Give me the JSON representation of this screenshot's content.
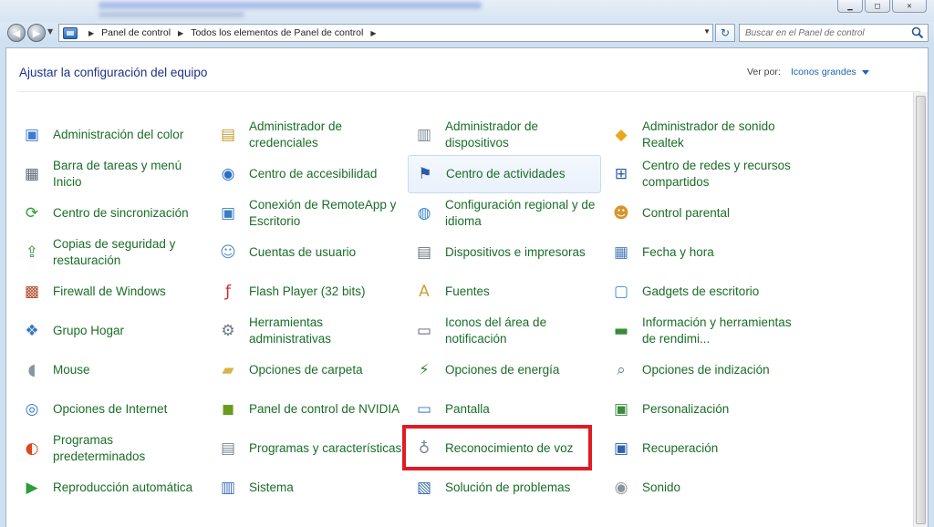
{
  "window": {
    "minimize": "▁",
    "maximize": "□",
    "close": "✕"
  },
  "nav": {
    "back": "◀",
    "forward": "▶",
    "breadcrumbs": [
      "Panel de control",
      "Todos los elementos de Panel de control"
    ],
    "search_placeholder": "Buscar en el Panel de control"
  },
  "header": {
    "title": "Ajustar la configuración del equipo",
    "view_by_label": "Ver por:",
    "view_by_value": "Iconos grandes"
  },
  "colors": {
    "item_text": "#1a6d28",
    "heading": "#1e3287",
    "link": "#1e62b5",
    "highlight_box": "#e01b24"
  },
  "items": [
    {
      "label": "Administración del color",
      "icon": "color-management-icon"
    },
    {
      "label": "Administrador de credenciales",
      "icon": "credentials-icon"
    },
    {
      "label": "Administrador de dispositivos",
      "icon": "device-manager-icon"
    },
    {
      "label": "Administrador de sonido Realtek",
      "icon": "realtek-icon"
    },
    {
      "label": "Barra de tareas y menú Inicio",
      "icon": "taskbar-icon"
    },
    {
      "label": "Centro de accesibilidad",
      "icon": "accessibility-icon"
    },
    {
      "label": "Centro de actividades",
      "icon": "action-center-flag-icon"
    },
    {
      "label": "Centro de redes y recursos compartidos",
      "icon": "network-icon"
    },
    {
      "label": "Centro de sincronización",
      "icon": "sync-icon"
    },
    {
      "label": "Conexión de RemoteApp y Escritorio",
      "icon": "remoteapp-icon"
    },
    {
      "label": "Configuración regional y de idioma",
      "icon": "globe-clock-icon"
    },
    {
      "label": "Control parental",
      "icon": "parental-control-icon"
    },
    {
      "label": "Copias de seguridad y restauración",
      "icon": "backup-icon"
    },
    {
      "label": "Cuentas de usuario",
      "icon": "users-icon"
    },
    {
      "label": "Dispositivos e impresoras",
      "icon": "printer-icon"
    },
    {
      "label": "Fecha y hora",
      "icon": "calendar-clock-icon"
    },
    {
      "label": "Firewall de Windows",
      "icon": "firewall-icon"
    },
    {
      "label": "Flash Player (32 bits)",
      "icon": "flash-icon"
    },
    {
      "label": "Fuentes",
      "icon": "fonts-icon"
    },
    {
      "label": "Gadgets de escritorio",
      "icon": "gadgets-icon"
    },
    {
      "label": "Grupo Hogar",
      "icon": "homegroup-icon"
    },
    {
      "label": "Herramientas administrativas",
      "icon": "admin-tools-icon"
    },
    {
      "label": "Iconos del área de notificación",
      "icon": "notification-area-icon"
    },
    {
      "label": "Información y herramientas de rendimi...",
      "icon": "performance-icon"
    },
    {
      "label": "Mouse",
      "icon": "mouse-icon"
    },
    {
      "label": "Opciones de carpeta",
      "icon": "folder-options-icon"
    },
    {
      "label": "Opciones de energía",
      "icon": "power-icon"
    },
    {
      "label": "Opciones de indización",
      "icon": "indexing-icon"
    },
    {
      "label": "Opciones de Internet",
      "icon": "internet-options-icon"
    },
    {
      "label": "Panel de control de NVIDIA",
      "icon": "nvidia-icon"
    },
    {
      "label": "Pantalla",
      "icon": "display-icon"
    },
    {
      "label": "Personalización",
      "icon": "personalization-icon"
    },
    {
      "label": "Programas predeterminados",
      "icon": "default-programs-icon"
    },
    {
      "label": "Programas y características",
      "icon": "programs-features-icon"
    },
    {
      "label": "Reconocimiento de voz",
      "icon": "microphone-icon"
    },
    {
      "label": "Recuperación",
      "icon": "recovery-icon"
    },
    {
      "label": "Reproducción automática",
      "icon": "autoplay-icon"
    },
    {
      "label": "Sistema",
      "icon": "system-icon"
    },
    {
      "label": "Solución de problemas",
      "icon": "troubleshooting-icon"
    },
    {
      "label": "Sonido",
      "icon": "sound-icon"
    }
  ]
}
